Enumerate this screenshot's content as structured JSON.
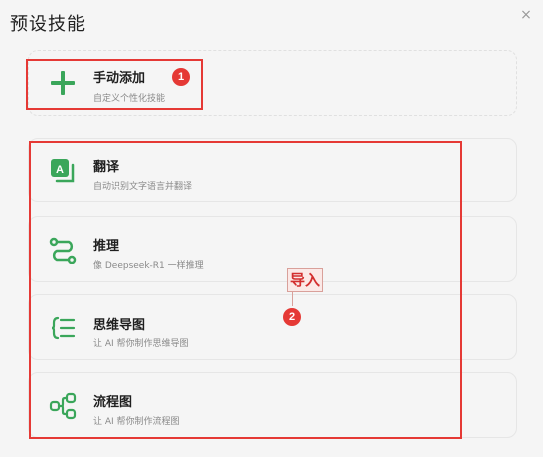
{
  "dialog": {
    "title": "预设技能",
    "close_symbol": "×"
  },
  "add_card": {
    "name": "手动添加",
    "desc": "自定义个性化技能"
  },
  "skills": [
    {
      "name": "翻译",
      "desc": "自动识别文字语言并翻译",
      "icon": "translate-icon"
    },
    {
      "name": "推理",
      "desc": "像 Deepseek-R1 一样推理",
      "icon": "reasoning-path-icon"
    },
    {
      "name": "思维导图",
      "desc": "让 AI 帮你制作思维导图",
      "icon": "mindmap-icon"
    },
    {
      "name": "流程图",
      "desc": "让 AI 帮你制作流程图",
      "icon": "flowchart-icon"
    }
  ],
  "annotations": {
    "badge_1": "1",
    "badge_2": "2",
    "import_label": "导入"
  },
  "colors": {
    "accent_green": "#3aa65a",
    "annotation_red": "#e53935"
  }
}
